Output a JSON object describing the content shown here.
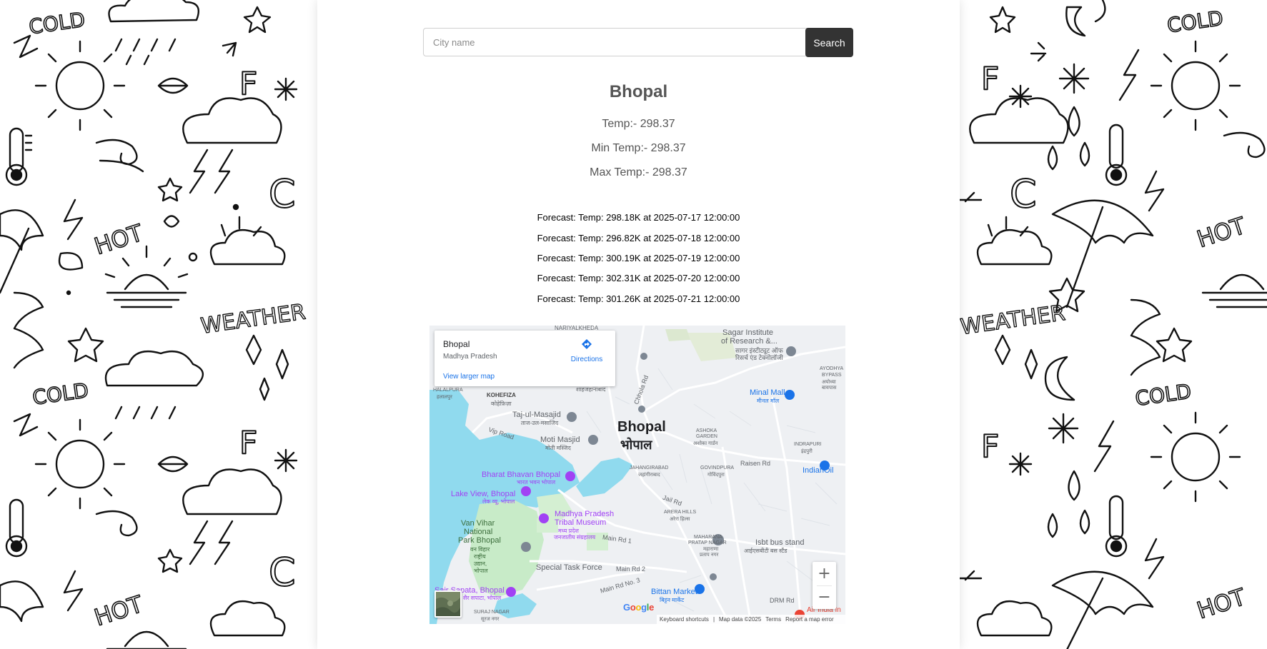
{
  "search": {
    "placeholder": "City name",
    "button_label": "Search"
  },
  "weather": {
    "city": "Bhopal",
    "temp": "Temp:- 298.37",
    "min_temp": "Min Temp:- 298.37",
    "max_temp": "Max Temp:- 298.37"
  },
  "forecast": [
    "Forecast: Temp: 298.18K at 2025-07-17 12:00:00",
    "Forecast: Temp: 296.82K at 2025-07-18 12:00:00",
    "Forecast: Temp: 300.19K at 2025-07-19 12:00:00",
    "Forecast: Temp: 302.31K at 2025-07-20 12:00:00",
    "Forecast: Temp: 301.26K at 2025-07-21 12:00:00"
  ],
  "map": {
    "card": {
      "title": "Bhopal",
      "subtitle": "Madhya Pradesh",
      "directions_label": "Directions",
      "larger_map_label": "View larger map"
    },
    "city_label_en": "Bhopal",
    "city_label_hi": "भोपाल",
    "places": {
      "nariyalkheda": "NARIYALKHEDA",
      "sagar": "Sagar Institute",
      "sagar2": "of Research &...",
      "sagar_hi": "सागर इंस्टीट्यूट ऑफ",
      "sagar_hi2": "रिसर्च एंड टेक्नोलॉजी",
      "minal_mall": "Minal Mall",
      "minal_mall_hi": "मीनल मॉल",
      "ayodhya": "AYODHYA",
      "ayodhya2": "BYPASS",
      "ayodhya_hi": "अयोध्या",
      "ayodhya_hi2": "बायपास",
      "halalpura": "HALALPURA",
      "halalpura_hi": "हलालपुर",
      "kohefiza": "KOHEFIZA",
      "kohefiza_hi": "कोहेफ़िज़ा",
      "shahjahanabad_hi": "शाहजहानाबाद",
      "taj": "Taj-ul-Masajid",
      "taj_hi": "ताज-उल-मसाजिद",
      "vip_road": "Vip Road",
      "moti_masjid": "Moti Masjid",
      "moti_masjid_hi": "मोती मस्जिद",
      "chhola_rd": "Chhola Rd",
      "ashoka_garden": "ASHOKA",
      "ashoka_garden2": "GARDEN",
      "ashoka_garden_hi": "अशोका गार्डन",
      "indrapuri": "INDRAPURI",
      "indrapuri_hi": "इंद्रपुरी",
      "bharat_bhavan": "Bharat Bhavan Bhopal",
      "bharat_bhavan_hi": "भारत भवन भोपाल",
      "jahangirabad": "JAHANGIRABAD",
      "jahangirabad_hi": "जहांगीराबाद",
      "govindpura": "GOVINDPURA",
      "govindpura_hi": "गोविंदपुरा",
      "raisen_rd": "Raisen Rd",
      "indianoil": "IndianOil",
      "lake_view": "Lake View, Bhopal",
      "lake_view_hi": "लेक व्यू, भोपाल",
      "jail_rd": "Jail Rd",
      "tribal_museum": "Madhya Pradesh",
      "tribal_museum2": "Tribal Museum",
      "tribal_museum_hi": "मध्य प्रदेश",
      "tribal_museum_hi2": "जनजातीय संग्रहालय",
      "arera_hills": "ARERA HILLS",
      "arera_hills_hi": "अरेरा हिल्स",
      "van_vihar": "Van Vihar",
      "van_vihar2": "National",
      "van_vihar3": "Park Bhopal",
      "van_vihar_hi": "वन विहार",
      "van_vihar_hi2": "राष्ट्रीय",
      "van_vihar_hi3": "उद्यान,",
      "van_vihar_hi4": "भोपाल",
      "main_rd_1": "Main Rd 1",
      "maharana": "MAHARANA",
      "maharana2": "PRATAP NAGAR",
      "maharana_hi": "महाराणा",
      "maharana_hi2": "प्रताप नगर",
      "isbt": "Isbt bus stand",
      "isbt_hi": "आईएसबीटी बस स्टैंड",
      "special_task_force": "Special Task Force",
      "main_rd_2": "Main Rd 2",
      "main_rd_3": "Main Rd No. 3",
      "sair_sapata": "Sair Sapata, Bhopal",
      "sair_sapata_hi": "सैर सपाटा, भोपाल",
      "bittan_market": "Bittan Market",
      "bittan_market_hi": "बिट्टन मार्केट",
      "drm_rd": "DRM Rd",
      "suraj_nagar": "SURAJ NAGAR",
      "suraj_nagar_hi": "सूरज नगर",
      "air_india": "Air India In"
    },
    "google_logo": [
      "G",
      "o",
      "o",
      "g",
      "l",
      "e"
    ],
    "attribution": {
      "shortcuts": "Keyboard shortcuts",
      "map_data": "Map data ©2025",
      "terms": "Terms",
      "report": "Report a map error"
    }
  },
  "colors": {
    "search_button_bg": "#333333",
    "text_muted": "#555555",
    "water": "#90daee",
    "park": "#c8ebc8",
    "link_blue": "#1a73e8",
    "poi_purple": "#a142f4"
  }
}
